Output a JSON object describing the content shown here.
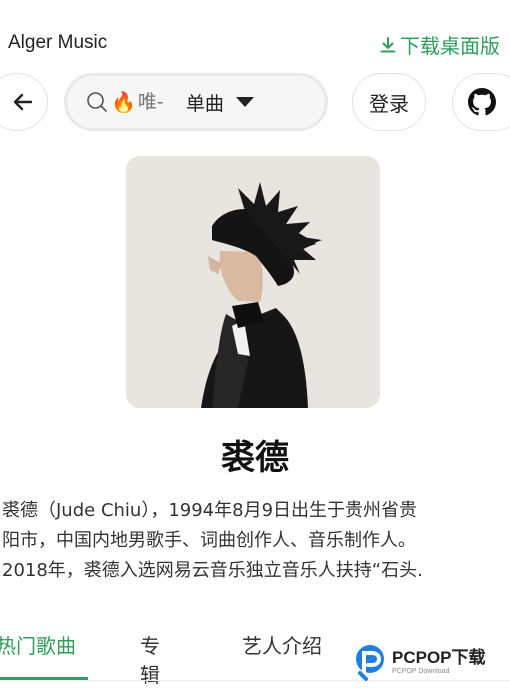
{
  "header": {
    "app_title": "Alger Music",
    "download_label": "下载桌面版",
    "download_icon": "download-icon"
  },
  "search": {
    "back_icon": "arrow-left-icon",
    "search_icon": "search-icon",
    "hot_icon": "🔥",
    "placeholder": "唯-",
    "type_label": "单曲",
    "type_icon": "caret-down-icon"
  },
  "account": {
    "login_label": "登录",
    "github_icon": "github-icon"
  },
  "artist": {
    "name": "裘德",
    "description_lines": [
      "裘德（Jude Chiu），1994年8月9日出生于贵州省贵",
      "阳市，中国内地男歌手、词曲创作人、音乐制作人。",
      "2018年，裘德入选网易云音乐独立音乐人扶持“石头."
    ]
  },
  "tabs": [
    {
      "label": "热门歌曲",
      "active": true
    },
    {
      "label": "专辑",
      "active": false
    },
    {
      "label": "艺人介绍",
      "active": false
    }
  ],
  "watermark": {
    "main": "PCPOP下载",
    "sub": "PCPOP Download"
  },
  "colors": {
    "accent": "#2f9e5a"
  }
}
